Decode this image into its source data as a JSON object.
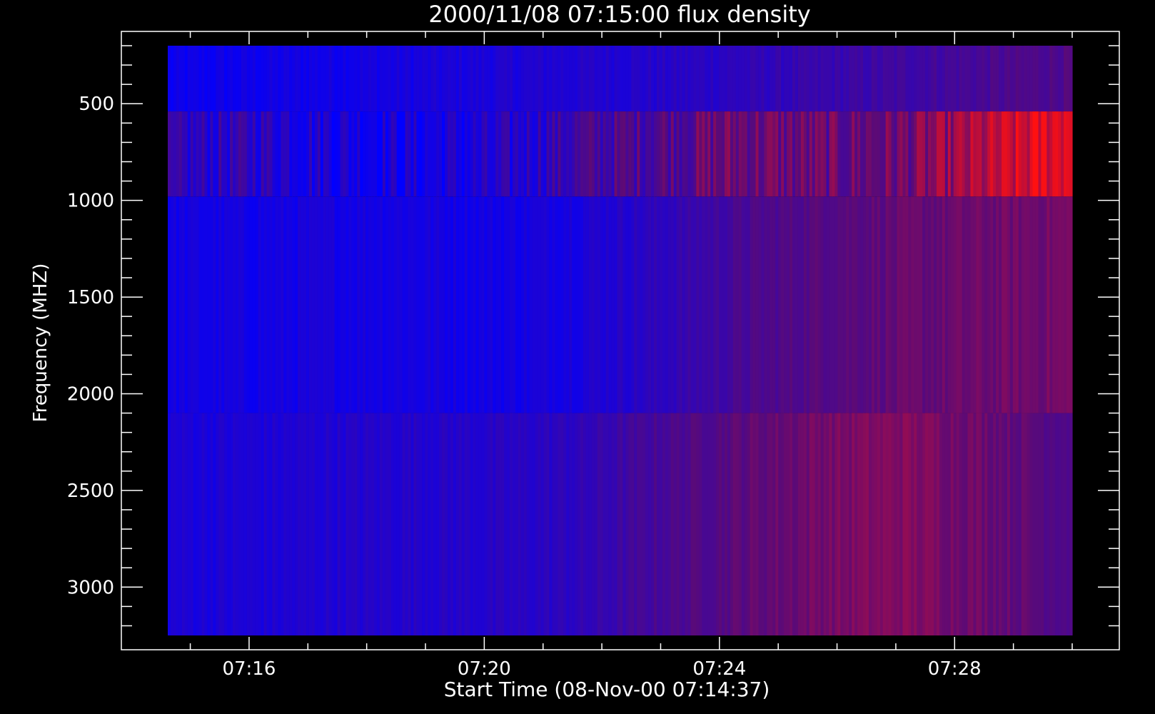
{
  "chart_data": {
    "type": "heatmap",
    "title": "2000/11/08 07:15:00 flux density",
    "xlabel": "Start Time (08-Nov-00 07:14:37)",
    "ylabel": "Frequency (MHZ)",
    "xlim": [
      "07:14:37",
      "07:30:00"
    ],
    "ylim": [
      3250,
      200
    ],
    "x_ticks": [
      "07:16",
      "07:20",
      "07:24",
      "07:28"
    ],
    "y_ticks": [
      500,
      1000,
      1500,
      2000,
      2500,
      3000
    ],
    "colors": {
      "low": "#0000ff",
      "mid": "#5a0a78",
      "high": "#ff1010",
      "background": "#000000"
    },
    "bands": [
      {
        "name": "200-540 MHz",
        "freq_range": [
          200,
          540
        ],
        "intensity": [
          0.05,
          0.08,
          0.1,
          0.12,
          0.15,
          0.18,
          0.2,
          0.25,
          0.3,
          0.35,
          0.4,
          0.45
        ]
      },
      {
        "name": "540-980 MHz",
        "freq_range": [
          540,
          980
        ],
        "intensity": [
          0.2,
          0.25,
          0.15,
          0.1,
          0.15,
          0.35,
          0.45,
          0.55,
          0.5,
          0.55,
          0.75,
          0.95
        ]
      },
      {
        "name": "980-2100 MHz",
        "freq_range": [
          980,
          2100
        ],
        "intensity": [
          0.1,
          0.1,
          0.12,
          0.12,
          0.1,
          0.15,
          0.25,
          0.4,
          0.48,
          0.52,
          0.55,
          0.58
        ]
      },
      {
        "name": "2100-3250 MHz",
        "freq_range": [
          2100,
          3250
        ],
        "intensity": [
          0.15,
          0.15,
          0.18,
          0.2,
          0.2,
          0.25,
          0.4,
          0.5,
          0.58,
          0.62,
          0.55,
          0.45
        ]
      }
    ]
  }
}
